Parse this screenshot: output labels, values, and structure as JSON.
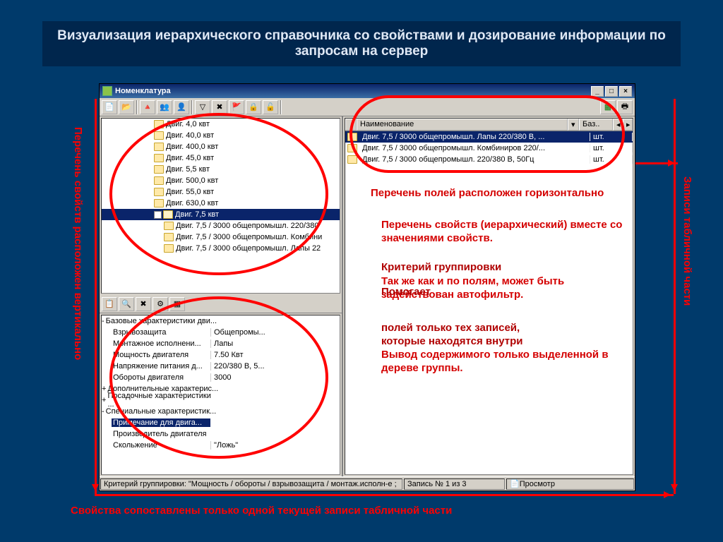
{
  "slide": {
    "title": "Визуализация иерархического справочника со свойствами и дозирование информации по запросам на сервер"
  },
  "labels": {
    "left_vertical": "Перечень свойств расположен вертикально",
    "right_vertical": "Записи табличной части",
    "bottom": "Свойства сопоставлены только одной текущей записи табличной части"
  },
  "window": {
    "title": "Номенклатура",
    "btn_min": "_",
    "btn_max": "□",
    "btn_close": "×"
  },
  "tree1": [
    {
      "indent": 5,
      "label": "Двиг. 4,0 квт"
    },
    {
      "indent": 5,
      "label": "Двиг. 40,0 квт"
    },
    {
      "indent": 5,
      "label": "Двиг. 400,0 квт"
    },
    {
      "indent": 5,
      "label": "Двиг. 45,0 квт"
    },
    {
      "indent": 5,
      "label": "Двиг. 5,5 квт"
    },
    {
      "indent": 5,
      "label": "Двиг. 500,0 квт"
    },
    {
      "indent": 5,
      "label": "Двиг. 55,0 квт"
    },
    {
      "indent": 5,
      "label": "Двиг. 630,0 квт"
    },
    {
      "indent": 5,
      "label": "Двиг. 7,5 квт",
      "open": true,
      "sel": true,
      "box": "-"
    },
    {
      "indent": 6,
      "label": "Двиг. 7,5 / 3000 общепромышл. 220/380"
    },
    {
      "indent": 6,
      "label": "Двиг. 7,5 / 3000 общепромышл. Комбини"
    },
    {
      "indent": 6,
      "label": "Двиг. 7,5 / 3000 общепромышл. Лапы 22"
    }
  ],
  "table": {
    "head_name": "Наименование",
    "head_unit": "Баз..",
    "rows": [
      {
        "name": "Двиг. 7,5 / 3000 общепромышл. Лапы 220/380 В, ...",
        "unit": "шт.",
        "sel": true
      },
      {
        "name": "Двиг. 7,5 / 3000 общепромышл. Комбиниров 220/...",
        "unit": "шт."
      },
      {
        "name": "Двиг. 7,5 / 3000 общепромышл. 220/380 В, 50Гц",
        "unit": "шт."
      }
    ]
  },
  "props": {
    "root": "Базовые характеристики дви...",
    "rows": [
      {
        "name": "Взрывозащита",
        "val": "Общепромы...",
        "globe": true
      },
      {
        "name": "Монтажное исполнени...",
        "val": "Лапы",
        "globe": true
      },
      {
        "name": "Мощность двигателя",
        "val": "7.50 Квт",
        "globe": true
      },
      {
        "name": "Напряжение питания д...",
        "val": "220/380 В, 5...",
        "globe": true
      },
      {
        "name": "Обороты двигателя",
        "val": "3000",
        "globe": true
      }
    ],
    "group2": "Дополнительные характерис...",
    "group3": "Посадочные характеристики ...",
    "group4": "Специальные характеристик...",
    "sub": [
      {
        "name": "Примечание для двига...",
        "val": "",
        "sel": true
      },
      {
        "name": "Производитель двигателя",
        "val": ""
      },
      {
        "name": "Скольжение",
        "val": "\"Ложь\""
      }
    ]
  },
  "status": {
    "criteria": "Критерий группировки: \"Мощность / обороты / взрывозащита / монтаж.исполн-е ;",
    "record": "Запись № 1 из 3",
    "view": "Просмотр"
  },
  "annotations": {
    "a1": "Перечень полей расположен горизонтально",
    "a2": "Перечень свойств (иерархический) вместе со значениями свойств.",
    "a3": "Критерий группировки",
    "a4": "Так же как и по полям, может быть задействован автофильтр.",
    "a5": "Помогает",
    "a6": "Вывод содержимого только выделенной в дереве группы.",
    "a7": "которые находятся внутри",
    "a8": "полей только тех записей,"
  }
}
